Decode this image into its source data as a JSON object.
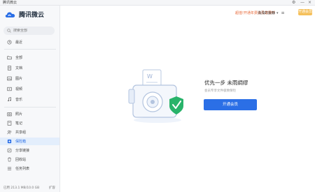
{
  "window": {
    "title": "腾讯微云",
    "controls": [
      "⚙",
      "—",
      "×"
    ]
  },
  "brand": {
    "name": "腾讯微云",
    "color": "#2b6fe6"
  },
  "search": {
    "placeholder": "搜索全部"
  },
  "sidebar": {
    "items": [
      {
        "label": "最近",
        "icon": "clock-icon"
      },
      {
        "label": "全部",
        "icon": "folder-icon"
      },
      {
        "label": "文档",
        "icon": "document-icon"
      },
      {
        "label": "图片",
        "icon": "image-icon"
      },
      {
        "label": "视频",
        "icon": "video-icon"
      },
      {
        "label": "音乐",
        "icon": "music-icon"
      },
      {
        "label": "照片",
        "icon": "photo-icon"
      },
      {
        "label": "笔记",
        "icon": "note-icon"
      },
      {
        "label": "共享组",
        "icon": "share-group-icon"
      },
      {
        "label": "保险箱",
        "icon": "safe-icon",
        "active": true
      },
      {
        "label": "分享链接",
        "icon": "link-icon"
      },
      {
        "label": "回收站",
        "icon": "trash-icon"
      },
      {
        "label": "任务列表",
        "icon": "task-list-icon"
      }
    ],
    "footer": {
      "usage": "已用 213.1 MB/10.0 GB",
      "expand": "扩容"
    }
  },
  "topbar": {
    "promo": "超值!开通年费会员享限时",
    "open_vip": "开通会员",
    "username": "浅浅的妄静",
    "menu": "≡"
  },
  "empty_state": {
    "title": "优先一步 未雨绸缪",
    "subtitle": "会员专享文件极致保险",
    "button": "开通会员"
  }
}
